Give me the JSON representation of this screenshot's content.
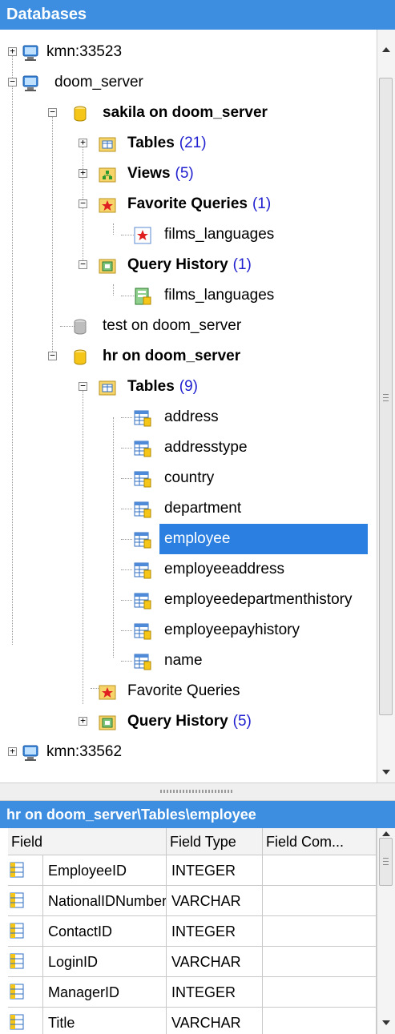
{
  "panel_title": "Databases",
  "tree": {
    "nodes": [
      {
        "label": "kmn:33523"
      },
      {
        "label": "doom_server"
      },
      {
        "label": "sakila on doom_server"
      },
      {
        "label": "Tables",
        "count": "(21)"
      },
      {
        "label": "Views",
        "count": "(5)"
      },
      {
        "label": "Favorite Queries",
        "count": "(1)"
      },
      {
        "label": "films_languages"
      },
      {
        "label": "Query History",
        "count": "(1)"
      },
      {
        "label": "films_languages"
      },
      {
        "label": "test on doom_server"
      },
      {
        "label": "hr on doom_server"
      },
      {
        "label": "Tables",
        "count": "(9)"
      },
      {
        "label": "address"
      },
      {
        "label": "addresstype"
      },
      {
        "label": "country"
      },
      {
        "label": "department"
      },
      {
        "label": "employee"
      },
      {
        "label": "employeeaddress"
      },
      {
        "label": "employeedepartmenthistory"
      },
      {
        "label": "employeepayhistory"
      },
      {
        "label": "name"
      },
      {
        "label": "Favorite Queries"
      },
      {
        "label": "Query History",
        "count": "(5)"
      },
      {
        "label": "kmn:33562"
      }
    ]
  },
  "object_panel_title": "hr on doom_server\\Tables\\employee",
  "grid": {
    "columns": [
      "Field",
      "Field Type",
      "Field Com..."
    ],
    "rows": [
      {
        "field": "EmployeeID",
        "type": "INTEGER"
      },
      {
        "field": "NationalIDNumber",
        "type": "VARCHAR"
      },
      {
        "field": "ContactID",
        "type": "INTEGER"
      },
      {
        "field": "LoginID",
        "type": "VARCHAR"
      },
      {
        "field": "ManagerID",
        "type": "INTEGER"
      },
      {
        "field": "Title",
        "type": "VARCHAR"
      }
    ]
  },
  "colors": {
    "title_bar": "#3d8ee0",
    "selection": "#2a7fe0",
    "count_text": "#2020d0"
  }
}
